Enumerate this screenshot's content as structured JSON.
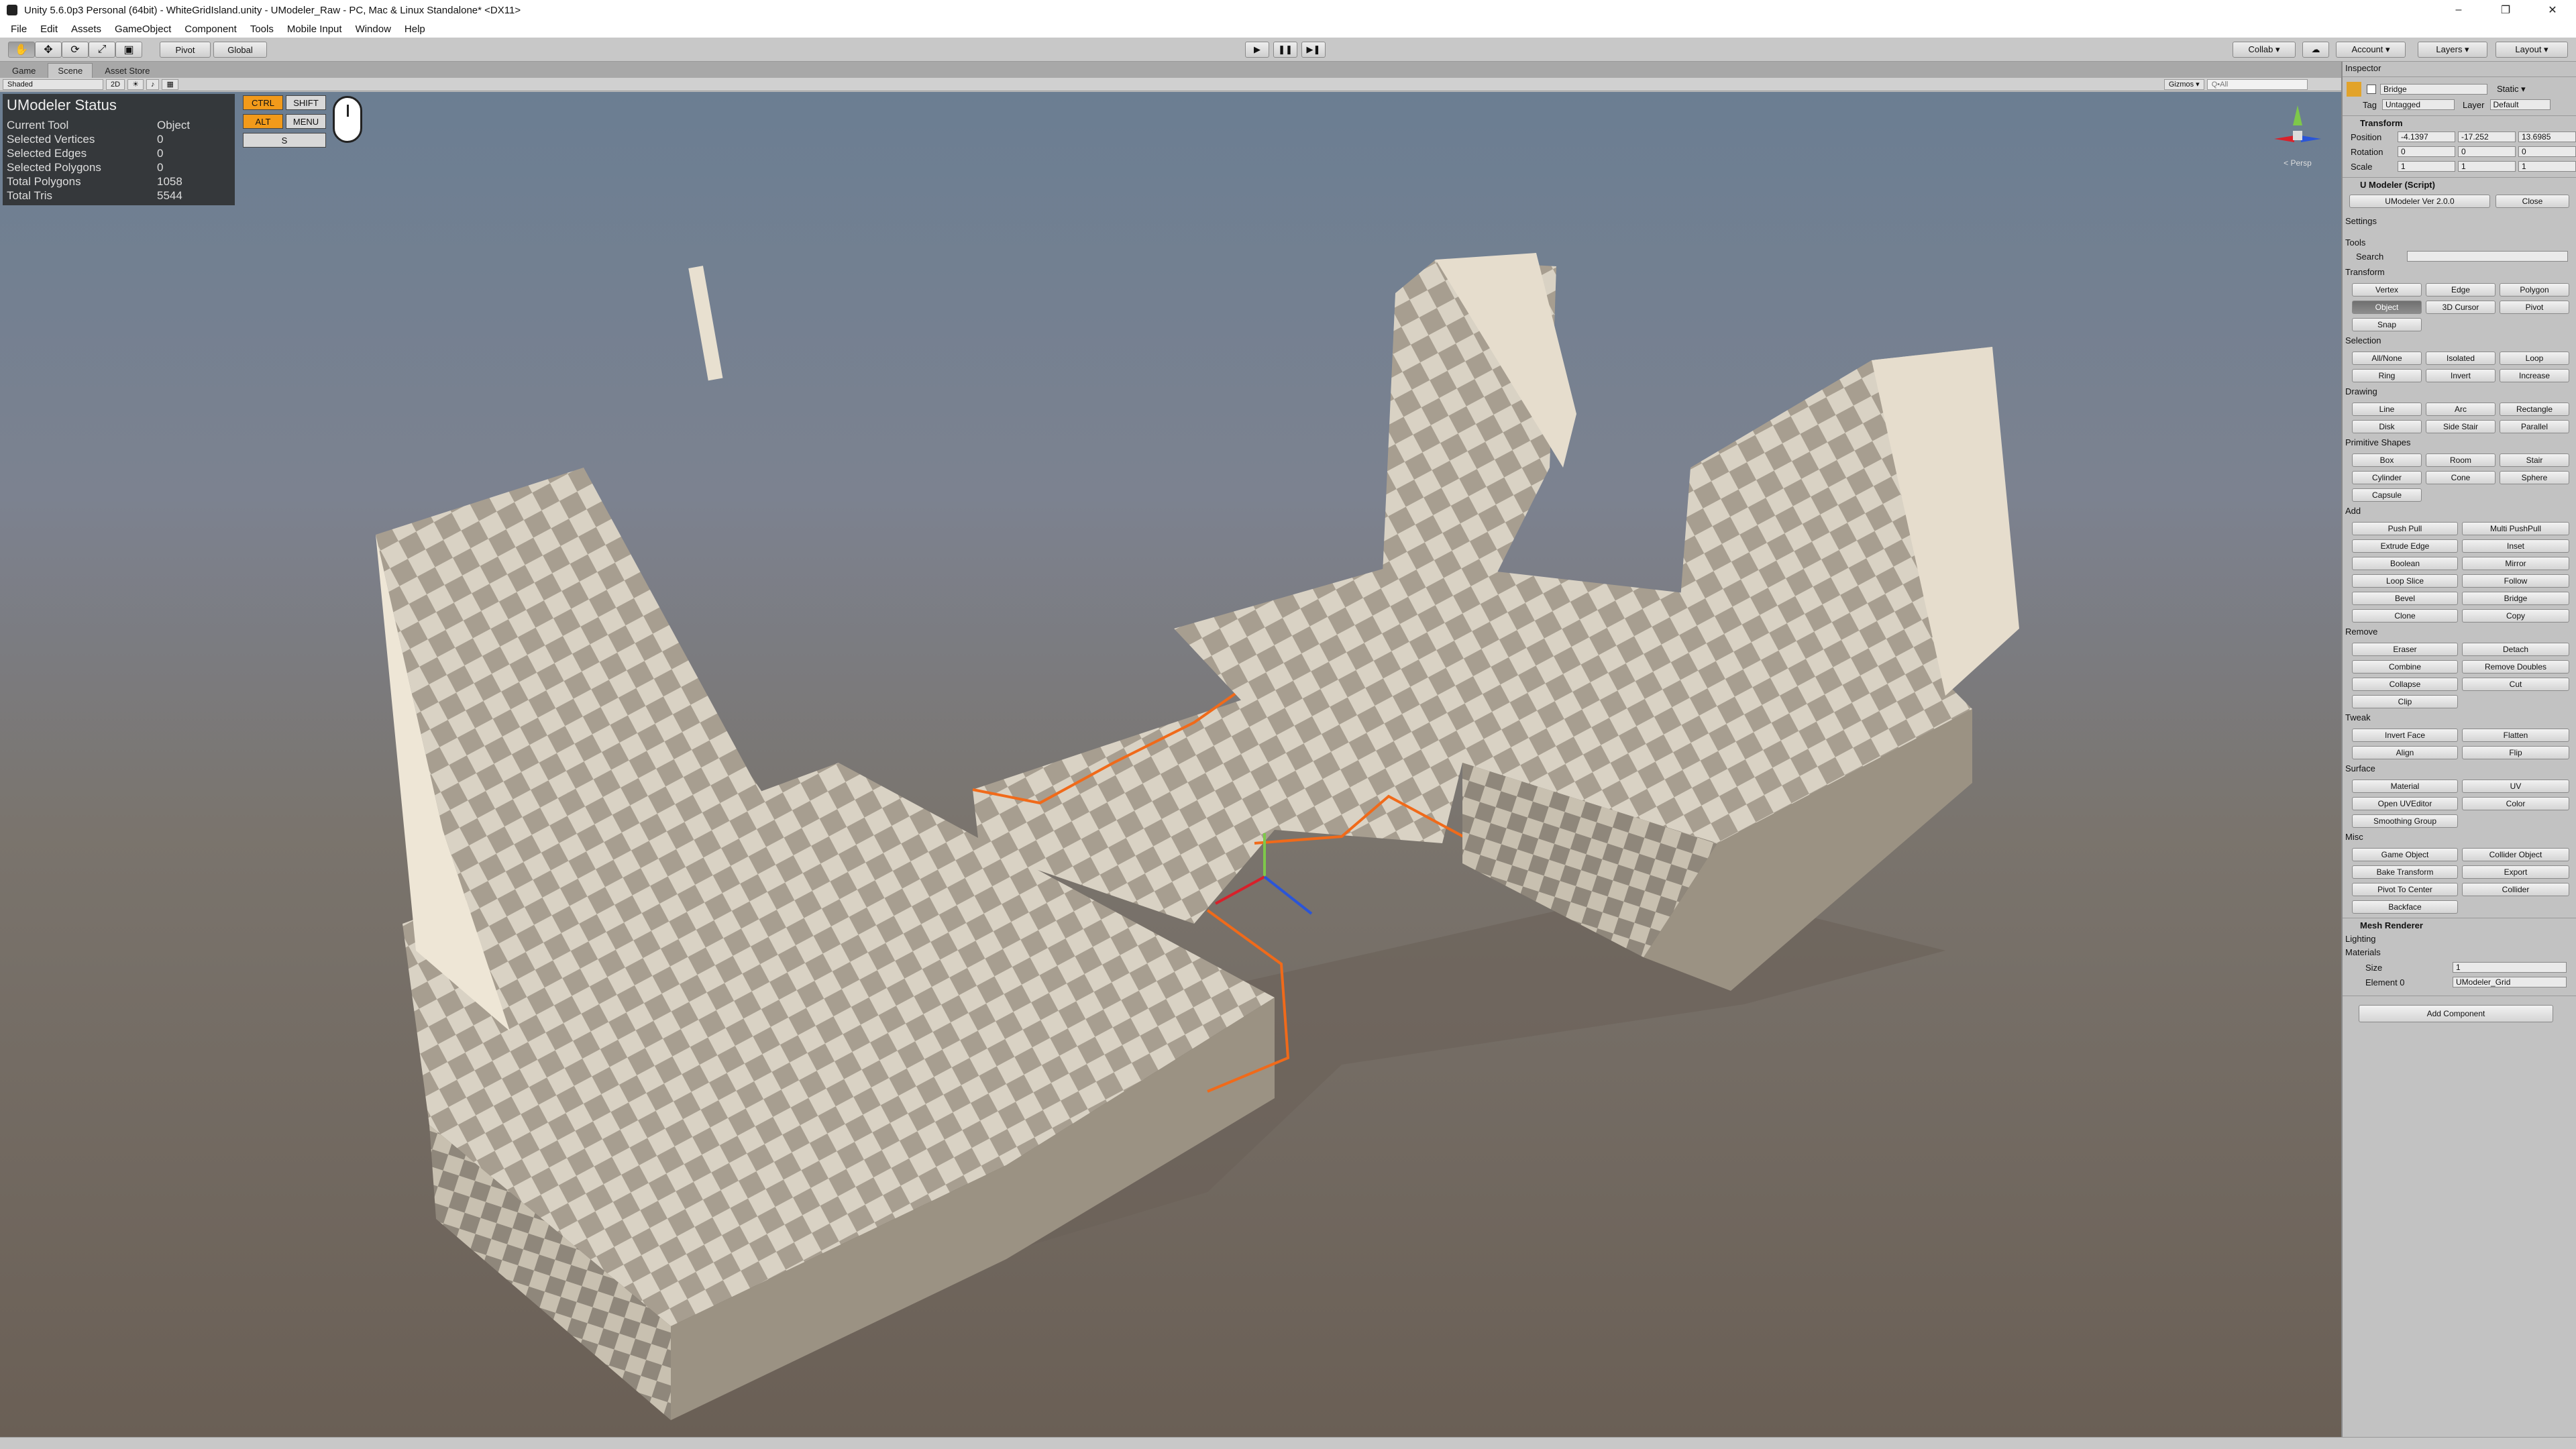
{
  "window": {
    "title": "Unity 5.6.0p3 Personal (64bit) - WhiteGridIsland.unity - UModeler_Raw - PC, Mac & Linux Standalone* <DX11>",
    "min": "–",
    "max": "❐",
    "close": "✕"
  },
  "menu": [
    "File",
    "Edit",
    "Assets",
    "GameObject",
    "Component",
    "Tools",
    "Mobile Input",
    "Window",
    "Help"
  ],
  "toolbar": {
    "pivot": "Pivot",
    "global": "Global",
    "play": "▶",
    "pause": "❚❚",
    "step": "▶❚",
    "collab": "Collab ▾",
    "account": "Account ▾",
    "layers": "Layers ▾",
    "layout": "Layout ▾"
  },
  "tabs": {
    "game": "Game",
    "scene": "Scene",
    "asset_store": "Asset Store"
  },
  "scenebar": {
    "shading": "Shaded",
    "mode2d": "2D",
    "gizmos": "Gizmos ▾",
    "search_placeholder": "Q•All"
  },
  "status": {
    "heading": "UModeler Status",
    "rows": [
      {
        "label": "Current Tool",
        "value": "Object"
      },
      {
        "label": "Selected Vertices",
        "value": "0"
      },
      {
        "label": "Selected Edges",
        "value": "0"
      },
      {
        "label": "Selected Polygons",
        "value": "0"
      },
      {
        "label": "Total Polygons",
        "value": "1058"
      },
      {
        "label": "Total Tris",
        "value": "5544"
      }
    ]
  },
  "keys": {
    "ctrl": "CTRL",
    "shift": "SHIFT",
    "alt": "ALT",
    "menu": "MENU",
    "s": "S"
  },
  "gizmo": {
    "label": "< Persp"
  },
  "inspector": {
    "tab": "Inspector",
    "object_name": "Bridge",
    "static_label": "Static ▾",
    "tag_label": "Tag",
    "tag_value": "Untagged",
    "layer_label": "Layer",
    "layer_value": "Default",
    "transform": {
      "title": "Transform",
      "position_label": "Position",
      "rotation_label": "Rotation",
      "scale_label": "Scale",
      "px": "-4.1397",
      "py": "-17.252",
      "pz": "13.6985",
      "rx": "0",
      "ry": "0",
      "rz": "0",
      "sx": "1",
      "sy": "1",
      "sz": "1"
    },
    "umodeler": {
      "title": "U Modeler (Script)",
      "version": "UModeler Ver 2.0.0",
      "close": "Close"
    },
    "settings": "Settings",
    "tools": "Tools",
    "search_label": "Search",
    "sections": {
      "transform": "Transform",
      "selection": "Selection",
      "drawing": "Drawing",
      "primitive": "Primitive Shapes",
      "add": "Add",
      "remove": "Remove",
      "tweak": "Tweak",
      "surface": "Surface",
      "misc": "Misc"
    },
    "btn": {
      "vertex": "Vertex",
      "edge": "Edge",
      "polygon": "Polygon",
      "object": "Object",
      "cursor3d": "3D Cursor",
      "pivot": "Pivot",
      "snap": "Snap",
      "allnone": "All/None",
      "isolated": "Isolated",
      "loop": "Loop",
      "ring": "Ring",
      "invert": "Invert",
      "increase": "Increase",
      "line": "Line",
      "arc": "Arc",
      "rectangle": "Rectangle",
      "disk": "Disk",
      "sidestair": "Side Stair",
      "parallel": "Parallel",
      "box": "Box",
      "room": "Room",
      "stair": "Stair",
      "cylinder": "Cylinder",
      "cone": "Cone",
      "sphere": "Sphere",
      "capsule": "Capsule",
      "pushpull": "Push Pull",
      "multipushpull": "Multi PushPull",
      "extrudeedge": "Extrude Edge",
      "inset": "Inset",
      "boolean": "Boolean",
      "mirror": "Mirror",
      "loopslice": "Loop Slice",
      "follow": "Follow",
      "bevel": "Bevel",
      "bridge": "Bridge",
      "clone": "Clone",
      "copy": "Copy",
      "eraser": "Eraser",
      "detach": "Detach",
      "combine": "Combine",
      "removedoubles": "Remove Doubles",
      "collapse": "Collapse",
      "cut": "Cut",
      "clip": "Clip",
      "invertface": "Invert Face",
      "flatten": "Flatten",
      "align": "Align",
      "flip": "Flip",
      "material": "Material",
      "uv": "UV",
      "openuveditor": "Open UVEditor",
      "color": "Color",
      "smoothinggroup": "Smoothing Group",
      "gameobject": "Game Object",
      "colliderobject": "Collider Object",
      "baketransform": "Bake Transform",
      "export": "Export",
      "pivottocenter": "Pivot To Center",
      "collider": "Collider",
      "backface": "Backface"
    },
    "meshrenderer": {
      "title": "Mesh Renderer",
      "lighting": "Lighting",
      "materials": "Materials",
      "size_label": "Size",
      "size": "1",
      "element_label": "Element 0",
      "element": "UModeler_Grid"
    },
    "add_component": "Add Component"
  }
}
